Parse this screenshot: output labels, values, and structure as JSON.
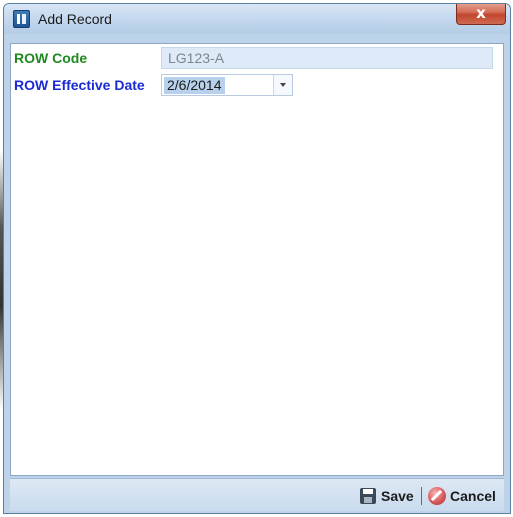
{
  "window": {
    "title": "Add Record",
    "close_label": "x"
  },
  "form": {
    "row_code": {
      "label": "ROW Code",
      "value": "LG123-A",
      "label_color": "#1f8a1f"
    },
    "row_effective_date": {
      "label": "ROW Effective Date",
      "value": "2/6/2014",
      "label_color": "#1a2bd6"
    }
  },
  "footer": {
    "save_label": "Save",
    "cancel_label": "Cancel"
  },
  "icons": {
    "app": "app-icon",
    "save": "floppy-disk-icon",
    "cancel": "cancel-icon",
    "dropdown": "chevron-down-icon"
  }
}
